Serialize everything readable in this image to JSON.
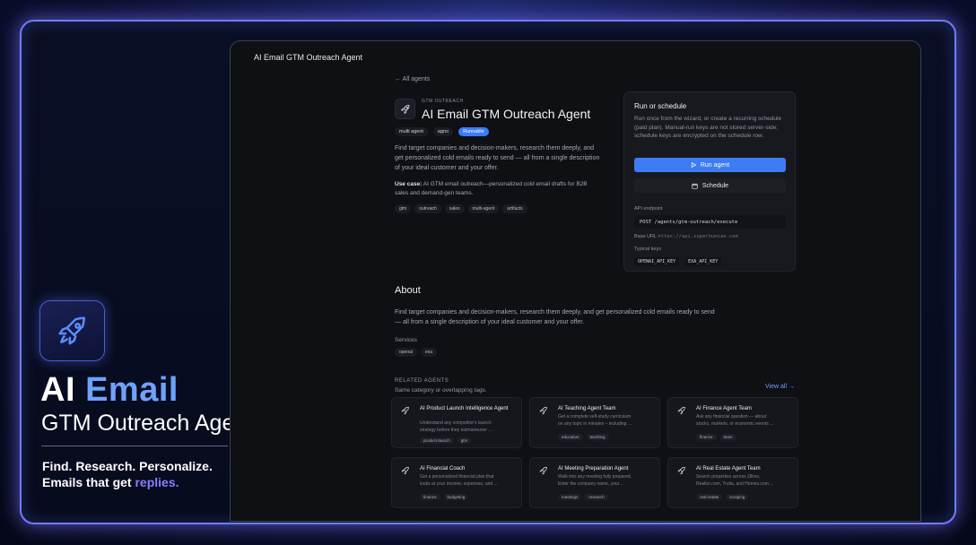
{
  "hero": {
    "title_line1_a": "AI",
    "title_line1_b": "Email",
    "title_line2": "GTM Outreach Agent",
    "tagline1": "Find. Research. Personalize.",
    "tagline2_a": "Emails that get",
    "tagline2_b": "replies.",
    "logo_icon": "rocket-icon"
  },
  "window": {
    "title": "AI Email GTM Outreach Agent"
  },
  "agent": {
    "back_label": "← All agents",
    "eyebrow": "GTM OUTREACH",
    "title": "AI Email GTM Outreach Agent",
    "chips": [
      "multi agent",
      "agno",
      "Runnable"
    ],
    "description": "Find target companies and decision-makers, research them deeply, and get personalized cold emails ready to send — all from a single description of your ideal customer and your offer.",
    "use_case_label": "Use case:",
    "use_case_text": " AI GTM email outreach—personalized cold email drafts for B2B sales and demand-gen teams.",
    "tags": [
      "gtm",
      "outreach",
      "sales",
      "multi-agent",
      "artifacts"
    ]
  },
  "run_card": {
    "title": "Run or schedule",
    "description": "Run once from the wizard, or create a recurring schedule (paid plan). Manual-run keys are not stored server-side; schedule keys are encrypted on the schedule row.",
    "run_label": "Run agent",
    "schedule_label": "Schedule",
    "endpoint_label": "API endpoint",
    "endpoint": "POST /agents/gtm-outreach/execute",
    "base_url_label": "Base URL",
    "base_url": "https://api.superhumian.com",
    "keys_label": "Typical keys",
    "keys": [
      "OPENAI_API_KEY",
      "EXA_API_KEY"
    ]
  },
  "about": {
    "heading": "About",
    "text": "Find target companies and decision-makers, research them deeply, and get personalized cold emails ready to send — all from a single description of your ideal customer and your offer.",
    "services_label": "Services",
    "services": [
      "openai",
      "exa"
    ]
  },
  "related": {
    "heading": "RELATED AGENTS",
    "subheading": "Same category or overlapping tags.",
    "view_all": "View all →",
    "cards": [
      {
        "title": "AI Product Launch Intelligence Agent",
        "desc1": "Understand any competitor's launch",
        "desc2": "strategy before they outmaneuver ...",
        "tags": [
          "product-launch",
          "gtm"
        ]
      },
      {
        "title": "AI Teaching Agent Team",
        "desc1": "Get a complete self-study curriculum",
        "desc2": "on any topic in minutes – including ...",
        "tags": [
          "education",
          "teaching"
        ]
      },
      {
        "title": "AI Finance Agent Team",
        "desc1": "Ask any financial question — about",
        "desc2": "stocks, markets, or economic events ...",
        "tags": [
          "finance",
          "team"
        ]
      },
      {
        "title": "AI Financial Coach",
        "desc1": "Get a personalized financial plan that",
        "desc2": "looks at your income, expenses, and ...",
        "tags": [
          "finance",
          "budgeting"
        ]
      },
      {
        "title": "AI Meeting Preparation Agent",
        "desc1": "Walk into any meeting fully prepared.",
        "desc2": "Enter the company name, your ...",
        "tags": [
          "meetings",
          "research"
        ]
      },
      {
        "title": "AI Real Estate Agent Team",
        "desc1": "Search properties across Zillow,",
        "desc2": "Realtor.com, Trulia, and Homes.com ...",
        "tags": [
          "real-estate",
          "scraping"
        ]
      }
    ]
  }
}
